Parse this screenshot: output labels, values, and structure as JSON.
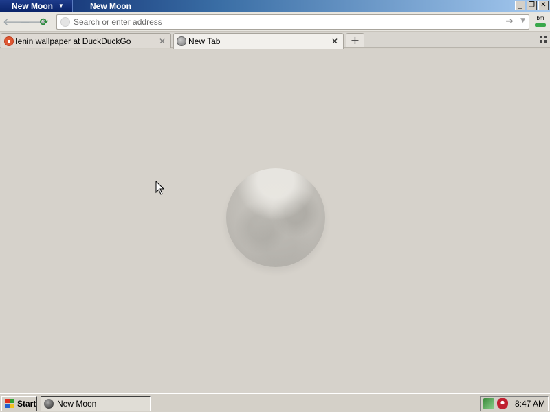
{
  "window": {
    "app_menu_label": "New Moon",
    "title": "New Moon",
    "controls": {
      "minimize": "_",
      "restore": "❐",
      "close": "✕"
    }
  },
  "navbar": {
    "back_icon": "back-arrow-icon",
    "forward_icon": "forward-arrow-icon",
    "reload_icon": "reload-icon",
    "url_placeholder": "Search or enter address",
    "url_value": "",
    "extension_label": "bm"
  },
  "tabs": [
    {
      "title": "lenin wallpaper at DuckDuckGo",
      "favicon": "duckduckgo-icon",
      "active": false
    },
    {
      "title": "New Tab",
      "favicon": "globe-icon",
      "active": true
    }
  ],
  "content": {
    "logo": "new-moon-logo"
  },
  "taskbar": {
    "start_label": "Start",
    "task_label": "New Moon",
    "clock": "8:47 AM"
  },
  "colors": {
    "title_bar": "#0a246a",
    "content_bg": "#d6d2cb",
    "reload_green": "#2a8c3a"
  }
}
